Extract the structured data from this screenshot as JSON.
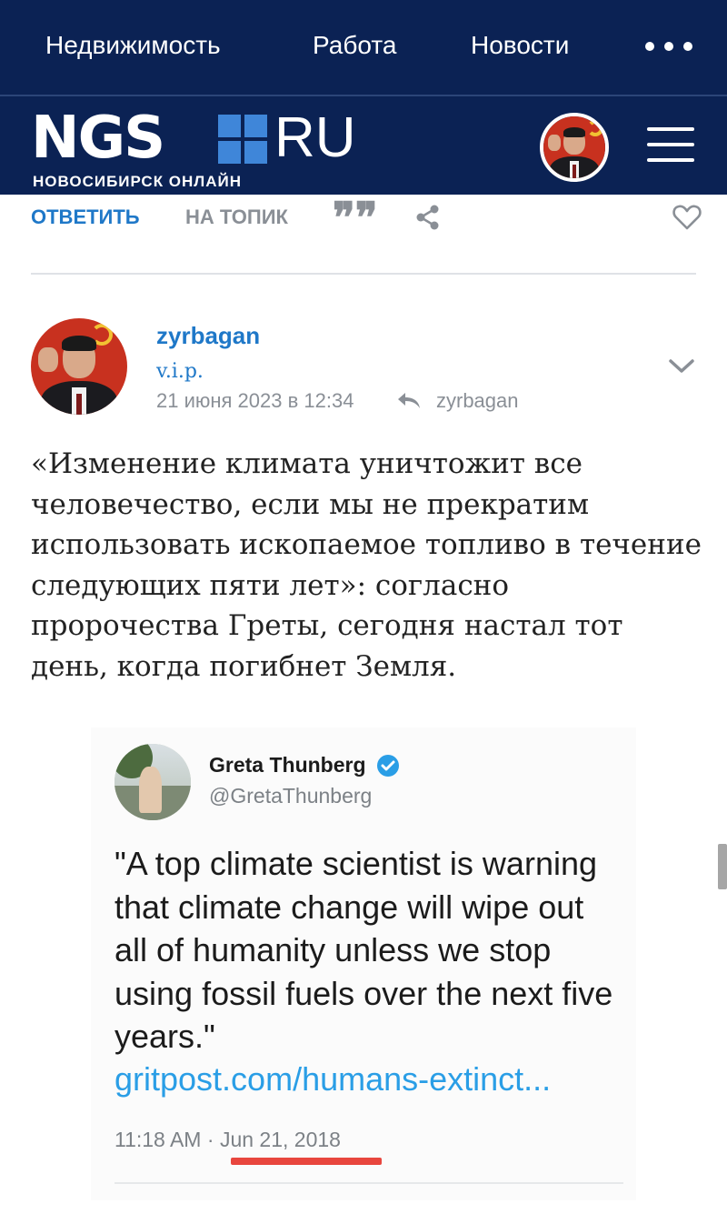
{
  "topnav": {
    "links": [
      "Недвижимость",
      "Работа",
      "Новости"
    ],
    "more_icon": "more-dots-icon"
  },
  "brand": {
    "logo_main": "NGS",
    "logo_domain": "RU",
    "logo_subtitle": "НОВОСИБИРСК ОНЛАЙН",
    "logo_square_color": "#3f86d9",
    "header_bg": "#0b2254",
    "menu_icon": "hamburger-menu-icon"
  },
  "actions": {
    "reply_label": "ОТВЕТИТЬ",
    "topic_label": "НА ТОПИК",
    "quote_glyph": "❞❞",
    "share_icon": "share-icon",
    "like_icon": "heart-icon",
    "accent": "#1f78c8"
  },
  "post": {
    "author": "zyrbagan",
    "rank": "v.i.p.",
    "date": "21 июня 2023 в 12:34",
    "reply_to": "zyrbagan",
    "text": "«Изменение климата уничтожит все человечество, если мы не прекратим использовать ископаемое топливо в течение следующих пяти лет»: согласно пророчества Греты, сегодня настал тот день, когда погибнет Земля."
  },
  "tweet": {
    "name": "Greta Thunberg",
    "handle": "@GretaThunberg",
    "text": "\"A top climate scientist is warning that climate change will wipe out all of humanity unless we stop using fossil fuels over the next five years.\"",
    "link": "gritpost.com/humans-extinct...",
    "time": "11:18 AM",
    "separator": "·",
    "date": "Jun 21, 2018",
    "highlight_color": "#e8463e",
    "link_color": "#2a9ee6"
  }
}
